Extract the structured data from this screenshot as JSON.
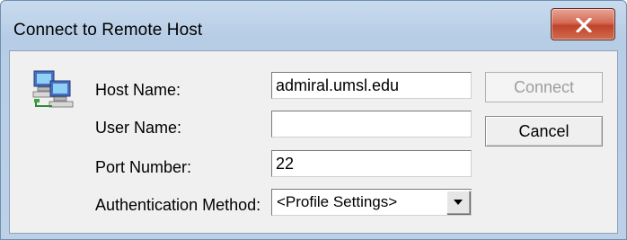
{
  "window": {
    "title": "Connect to Remote Host"
  },
  "form": {
    "host_name_label": "Host Name:",
    "host_name_value": "admiral.umsl.edu",
    "user_name_label": "User Name:",
    "user_name_value": "",
    "port_number_label": "Port Number:",
    "port_number_value": "22",
    "auth_method_label": "Authentication Method:",
    "auth_method_value": "<Profile Settings>"
  },
  "buttons": {
    "connect_label": "Connect",
    "connect_enabled": false,
    "cancel_label": "Cancel"
  },
  "icons": {
    "dialog_icon": "network-computers-icon",
    "close_icon": "close-icon",
    "dropdown_icon": "dropdown-arrow-icon"
  },
  "colors": {
    "close_button": "#c7452d",
    "titlebar": "#bcd1e8",
    "client_background": "#f0f0f0"
  }
}
